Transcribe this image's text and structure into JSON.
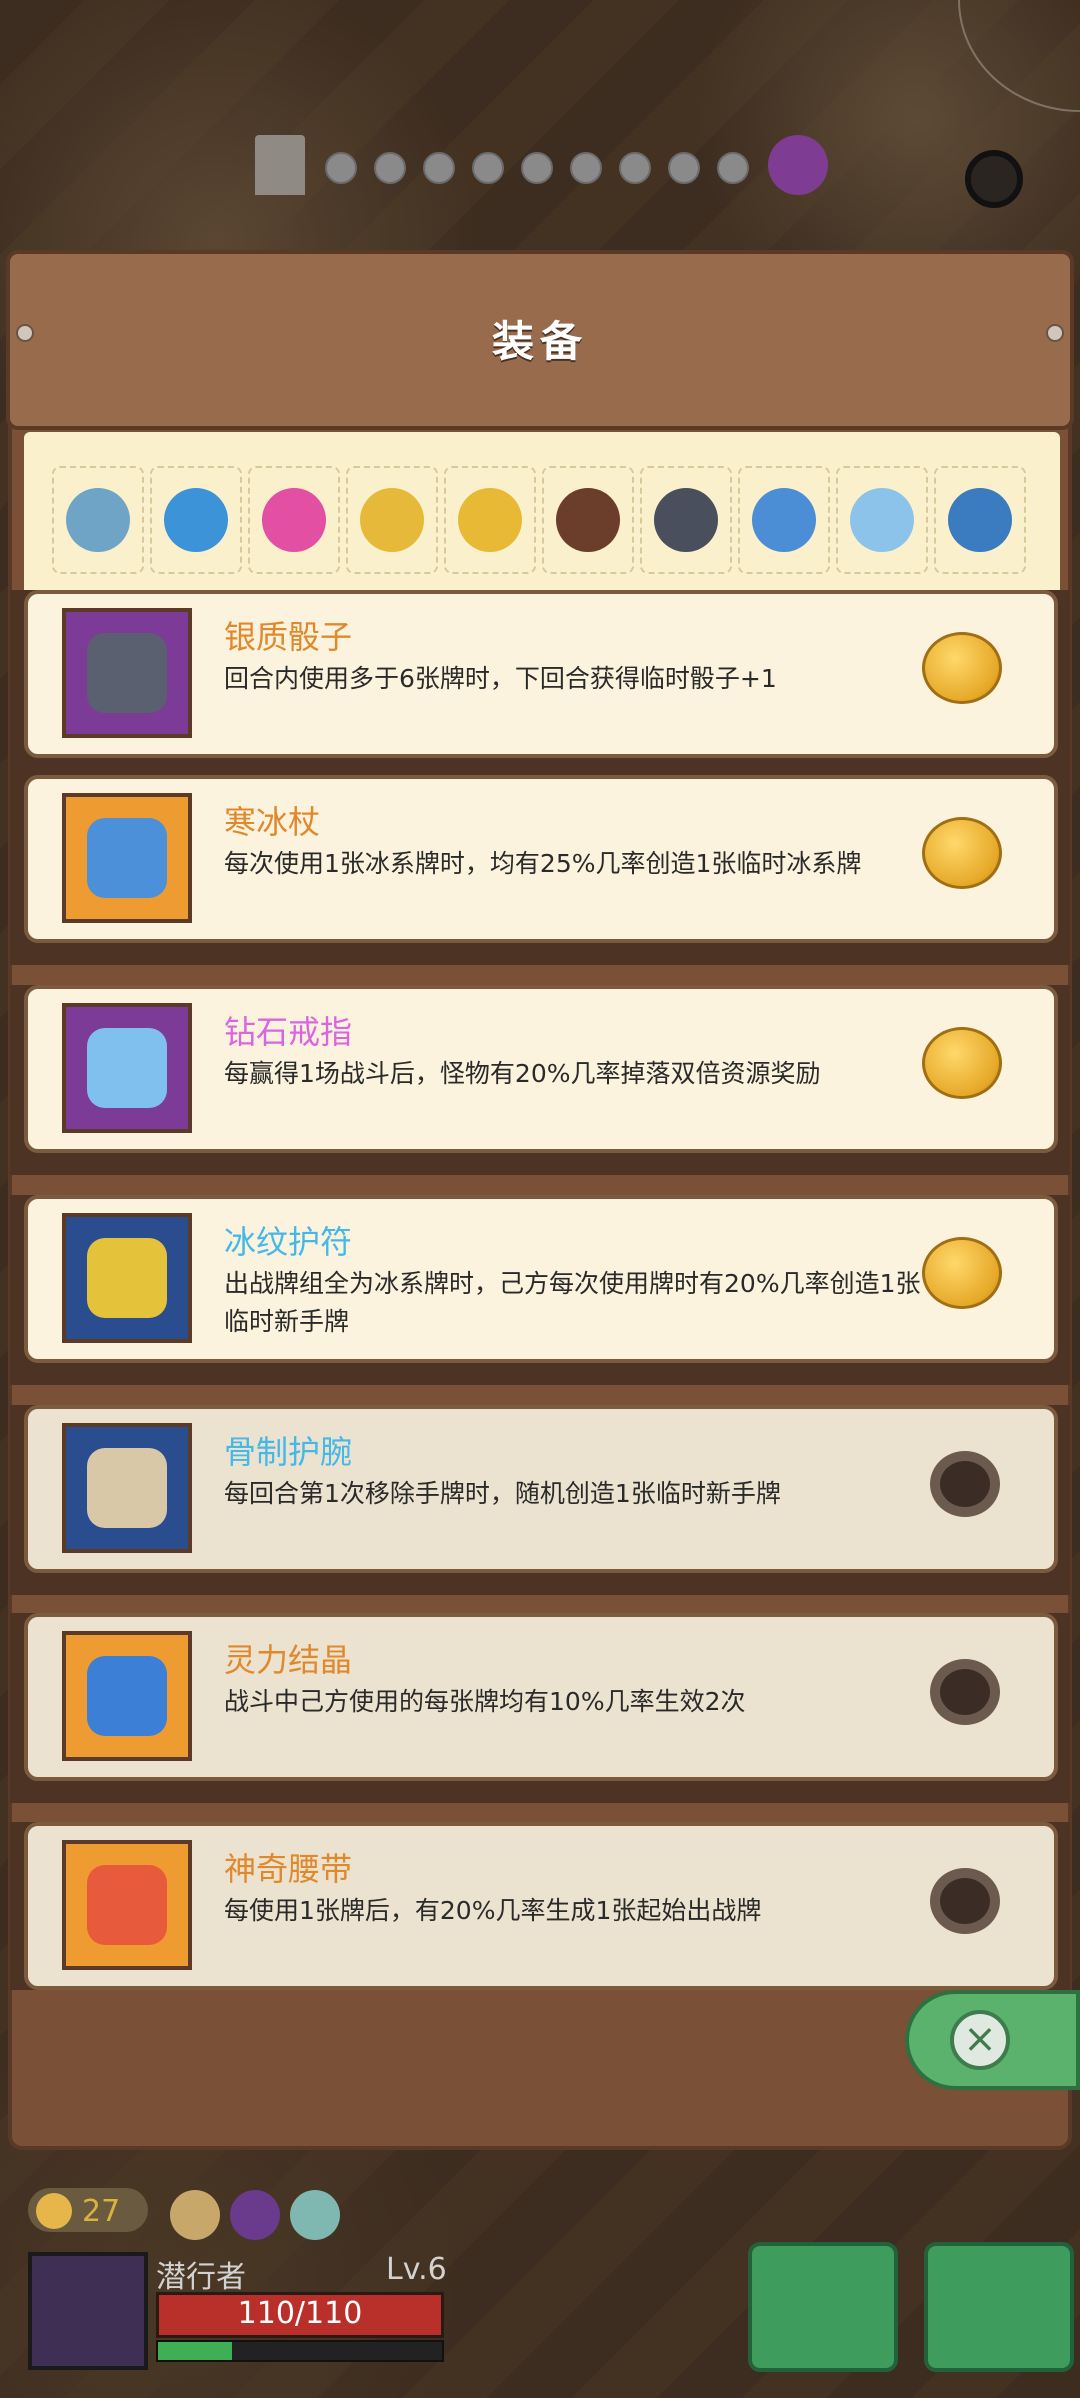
{
  "title": "装备",
  "strip_icons": [
    "pickaxe-icon",
    "water-drop-icon",
    "pink-orb-icon",
    "crown-icon",
    "gold-knot-icon",
    "button-icon",
    "silver-dice-icon",
    "ice-staff-icon",
    "diamond-ring-icon",
    "ice-amulet-icon"
  ],
  "cards": [
    {
      "name": "银质骰子",
      "desc": "回合内使用多于6张牌时，下回合获得临时骰子+1",
      "color": "#e0892c",
      "frame": "purple",
      "icon": "silver-dice-icon",
      "state": "coin"
    },
    {
      "name": "寒冰杖",
      "desc": "每次使用1张冰系牌时，均有25%几率创造1张临时冰系牌",
      "color": "#e0892c",
      "frame": "orange",
      "icon": "ice-staff-icon",
      "state": "coin"
    },
    {
      "name": "钻石戒指",
      "desc": "每赢得1场战斗后，怪物有20%几率掉落双倍资源奖励",
      "color": "#d966e0",
      "frame": "purple",
      "icon": "diamond-ring-icon",
      "state": "coin"
    },
    {
      "name": "冰纹护符",
      "desc": "出战牌组全为冰系牌时，己方每次使用牌时有20%几率创造1张临时新手牌",
      "color": "#45b8e8",
      "frame": "blue",
      "icon": "ice-amulet-icon",
      "state": "coin"
    },
    {
      "name": "骨制护腕",
      "desc": "每回合第1次移除手牌时，随机创造1张临时新手牌",
      "color": "#45b8e8",
      "frame": "blue",
      "icon": "bone-bracer-icon",
      "state": "empty"
    },
    {
      "name": "灵力结晶",
      "desc": "战斗中己方使用的每张牌均有10%几率生效2次",
      "color": "#e0892c",
      "frame": "orange",
      "icon": "spirit-crystal-icon",
      "state": "empty"
    },
    {
      "name": "神奇腰带",
      "desc": "每使用1张牌后，有20%几率生成1张起始出战牌",
      "color": "#e0892c",
      "frame": "orange",
      "icon": "magic-belt-icon",
      "state": "empty"
    }
  ],
  "hud": {
    "gold": "27",
    "player_name": "潜行者",
    "level": "Lv.6",
    "hp": "110/110",
    "xp_fraction": 0.26
  }
}
